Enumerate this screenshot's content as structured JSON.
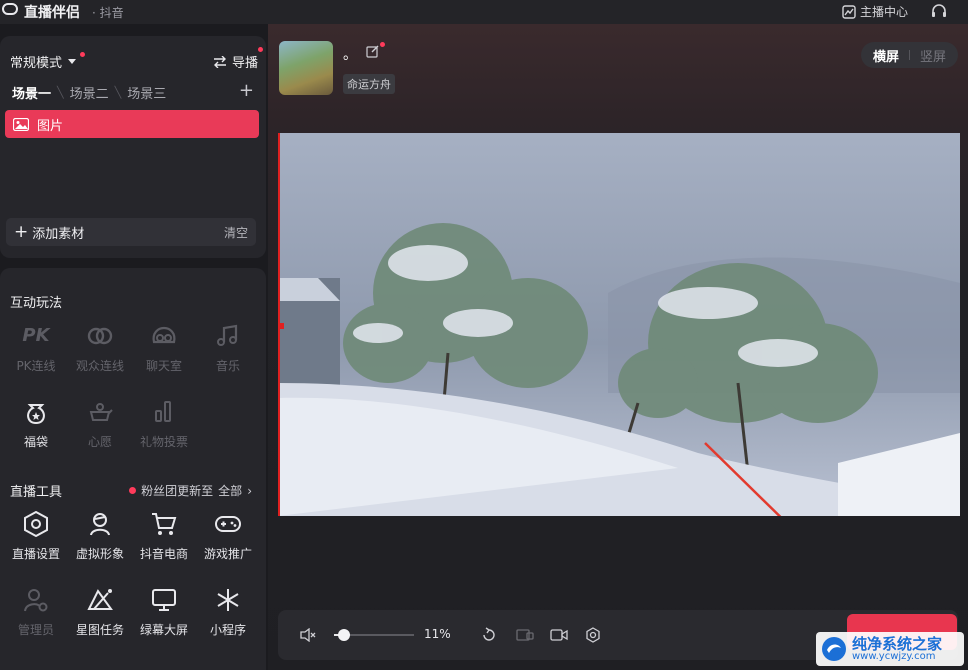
{
  "app": {
    "title": "直播伴侣",
    "subtitle": "· 抖音"
  },
  "topbar": {
    "creator_center": "主播中心"
  },
  "left_top": {
    "mode_label": "常规模式",
    "director_label": "导播",
    "scenes": [
      "场景一",
      "场景二",
      "场景三"
    ],
    "source_item": "图片",
    "add_source": "添加素材",
    "clear": "清空"
  },
  "interactive": {
    "title": "互动玩法",
    "items": [
      {
        "label": "PK连线",
        "icon": "pk-icon",
        "enabled": false
      },
      {
        "label": "观众连线",
        "icon": "link-icon",
        "enabled": false
      },
      {
        "label": "聊天室",
        "icon": "chatroom-icon",
        "enabled": false
      },
      {
        "label": "音乐",
        "icon": "music-icon",
        "enabled": false
      },
      {
        "label": "福袋",
        "icon": "lucky-bag-icon",
        "enabled": true
      },
      {
        "label": "心愿",
        "icon": "wish-icon",
        "enabled": false
      },
      {
        "label": "礼物投票",
        "icon": "gift-vote-icon",
        "enabled": false
      }
    ]
  },
  "live_tools": {
    "title": "直播工具",
    "fan_update": "粉丝团更新至",
    "all": "全部",
    "items": [
      {
        "label": "直播设置",
        "icon": "settings-hex-icon",
        "enabled": true
      },
      {
        "label": "虚拟形象",
        "icon": "avatar-icon",
        "enabled": true
      },
      {
        "label": "抖音电商",
        "icon": "cart-icon",
        "enabled": true
      },
      {
        "label": "游戏推广",
        "icon": "gamepad-icon",
        "enabled": true
      },
      {
        "label": "管理员",
        "icon": "admin-icon",
        "enabled": false
      },
      {
        "label": "星图任务",
        "icon": "star-task-icon",
        "enabled": true
      },
      {
        "label": "绿幕大屏",
        "icon": "green-screen-icon",
        "enabled": true
      },
      {
        "label": "小程序",
        "icon": "mini-program-icon",
        "enabled": true
      }
    ]
  },
  "room": {
    "name": "。",
    "tag": "命运方舟"
  },
  "orientation": {
    "landscape": "横屏",
    "portrait": "竖屏"
  },
  "controls": {
    "zoom": "11%",
    "volume_fraction": 0.11
  },
  "watermark": {
    "title": "纯净系统之家",
    "url": "www.ycwjzy.com"
  },
  "colors": {
    "accent": "#e8364f",
    "panel": "#26262b",
    "background": "#1b1b1f"
  }
}
